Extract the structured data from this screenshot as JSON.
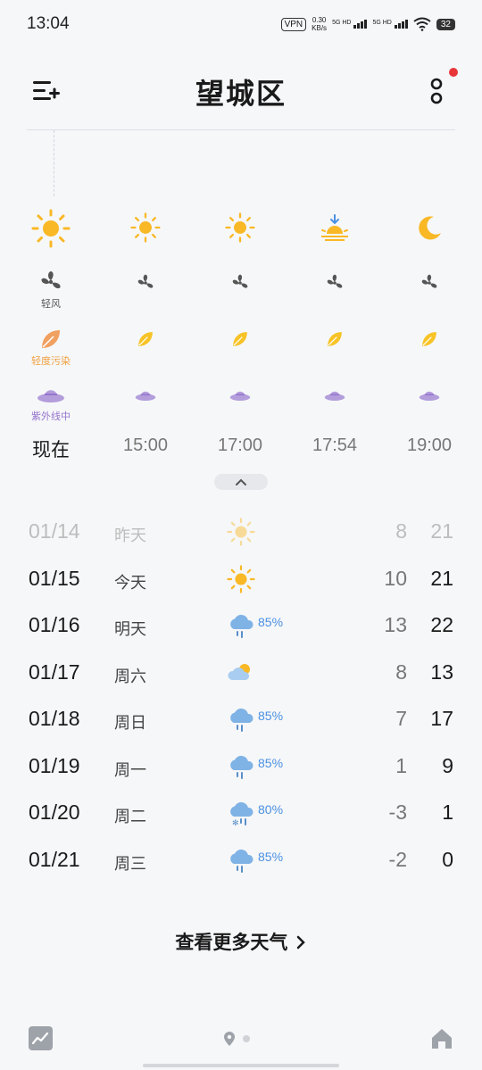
{
  "status_bar": {
    "time": "13:04",
    "vpn": "VPN",
    "speed_value": "0.30",
    "speed_unit": "KB/s",
    "net1": "5G HD",
    "net2": "5G HD",
    "battery": "32"
  },
  "header": {
    "city": "望城区"
  },
  "hourly": [
    {
      "time": "现在",
      "weather_icon": "sun-icon",
      "wind_label": "轻风",
      "air_label": "轻度污染",
      "uv_label": "紫外线中"
    },
    {
      "time": "15:00",
      "weather_icon": "sun-icon"
    },
    {
      "time": "17:00",
      "weather_icon": "sun-icon"
    },
    {
      "time": "17:54",
      "weather_icon": "sunset-icon"
    },
    {
      "time": "19:00",
      "weather_icon": "moon-icon"
    }
  ],
  "daily": [
    {
      "date": "01/14",
      "day": "昨天",
      "icon": "sun-icon",
      "precip": "",
      "low": "8",
      "high": "21"
    },
    {
      "date": "01/15",
      "day": "今天",
      "icon": "sun-icon",
      "precip": "",
      "low": "10",
      "high": "21"
    },
    {
      "date": "01/16",
      "day": "明天",
      "icon": "rain-icon",
      "precip": "85%",
      "low": "13",
      "high": "22"
    },
    {
      "date": "01/17",
      "day": "周六",
      "icon": "partly-cloudy-icon",
      "precip": "",
      "low": "8",
      "high": "13"
    },
    {
      "date": "01/18",
      "day": "周日",
      "icon": "rain-icon",
      "precip": "85%",
      "low": "7",
      "high": "17"
    },
    {
      "date": "01/19",
      "day": "周一",
      "icon": "rain-icon",
      "precip": "85%",
      "low": "1",
      "high": "9"
    },
    {
      "date": "01/20",
      "day": "周二",
      "icon": "sleet-icon",
      "precip": "80%",
      "low": "-3",
      "high": "1"
    },
    {
      "date": "01/21",
      "day": "周三",
      "icon": "rain-icon",
      "precip": "85%",
      "low": "-2",
      "high": "0"
    }
  ],
  "more_weather": "查看更多天气",
  "colors": {
    "sun": "#f9b825",
    "leaf": "#f7c326",
    "leaf_now": "#f0a060",
    "air_text": "#f0a040",
    "uv": "#b39ddb",
    "uv_text": "#9575cd",
    "rain": "#7fb3e6",
    "badge": "#e8373a"
  }
}
